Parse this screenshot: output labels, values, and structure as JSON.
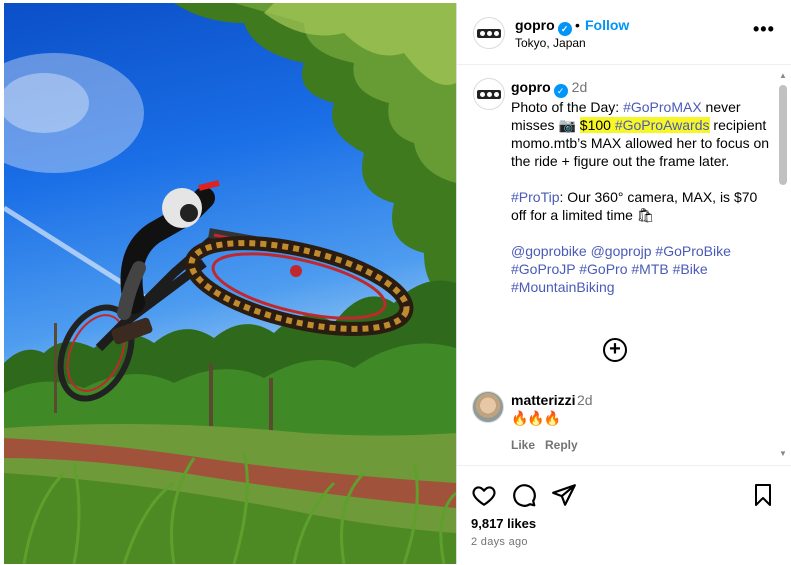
{
  "header": {
    "username": "gopro",
    "follow_separator": "•",
    "follow_label": "Follow",
    "location": "Tokyo, Japan",
    "more_label": "•••"
  },
  "caption": {
    "username": "gopro",
    "time": "2d",
    "line1_prefix": "Photo of the Day: ",
    "line1_tag": "#GoProMAX",
    "line1_suffix": " never misses ",
    "camera_emoji": "📷",
    "highlight_amount": "$100",
    "highlight_tag": "#GoProAwards",
    "line1_rest": " recipient momo.mtb’s MAX allowed her to focus on the ride + figure out the frame later.",
    "protip_tag": "#ProTip",
    "protip_text": ": Our 360° camera, MAX, is $70 off for a limited time ",
    "bag_emoji": "🛍",
    "hashtags": [
      "@goprobike",
      "@goprojp",
      "#GoProBike",
      "#GoProJP",
      "#GoPro",
      "#MTB",
      "#Bike",
      "#MountainBiking"
    ]
  },
  "load_more_label": "+",
  "comment": {
    "username": "matterizzi",
    "time": "2d",
    "text": "🔥🔥🔥",
    "like_label": "Like",
    "reply_label": "Reply"
  },
  "scrollbar": {
    "up": "▲",
    "down": "▼"
  },
  "actions": {
    "likes": "9,817 likes",
    "posted": "2 days ago"
  },
  "icons": [
    "heart-icon",
    "comment-icon",
    "share-icon",
    "bookmark-icon",
    "verified-badge-icon",
    "plus-circle-icon",
    "more-icon"
  ],
  "colors": {
    "link_blue": "#0095f6",
    "hashtag": "#4a5ab7",
    "highlight": "#f7f728",
    "muted": "#737373"
  }
}
